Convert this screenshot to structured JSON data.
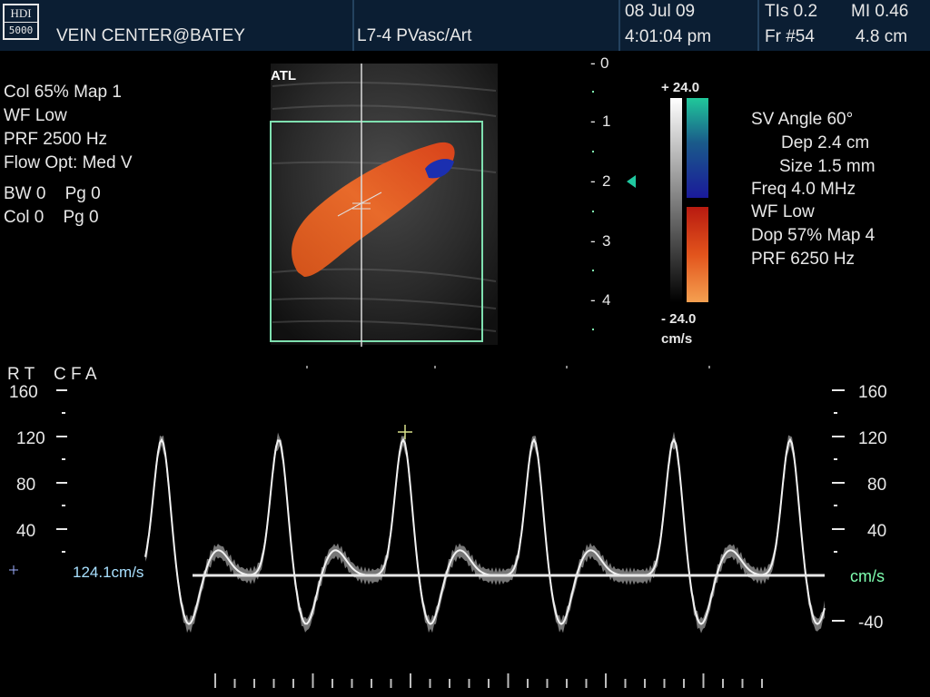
{
  "header": {
    "logo_line1": "HDI",
    "logo_line2": "5000",
    "site": "VEIN CENTER@BATEY",
    "transducer": "L7-4 PVasc/Art",
    "date": "08 Jul 09",
    "time": "4:01:04 pm",
    "tis": "TIs 0.2",
    "mi": "MI 0.46",
    "frame": "Fr #54",
    "depth": "4.8 cm"
  },
  "left_params": {
    "col": "Col 65%  Map 1",
    "wf": "WF Low",
    "prf": "PRF 2500  Hz",
    "flow": "Flow Opt: Med V",
    "bw": "BW 0    Pg 0",
    "col2": "Col 0    Pg 0"
  },
  "right_params": {
    "sv_angle": "SV Angle 60°",
    "dep": "Dep 2.4  cm",
    "size": "Size 1.5  mm",
    "freq": "Freq 4.0  MHz",
    "wf": "WF Low",
    "dop": "Dop 57%  Map 4",
    "prf": "PRF 6250  Hz"
  },
  "image": {
    "atl_label": "ATL",
    "depth_scale": [
      "0",
      "1",
      "2",
      "3",
      "4"
    ]
  },
  "color_bar": {
    "top": "+ 24.0",
    "bottom": "- 24.0",
    "unit": "cm/s"
  },
  "spectral": {
    "label": "R T    C F A",
    "velocity_readout": "124.1cm/s",
    "left_ticks": [
      "160",
      "120",
      "80",
      "40"
    ],
    "right_ticks": [
      "160",
      "120",
      "80",
      "40",
      "-40"
    ],
    "unit": "cm/s"
  },
  "colors": {
    "header_bg": "#0b1e33",
    "flow_red": "#e0581e",
    "flow_blue": "#1b2fb0",
    "roi_green": "#7fe0b0",
    "accent_green": "#7fffb0"
  }
}
